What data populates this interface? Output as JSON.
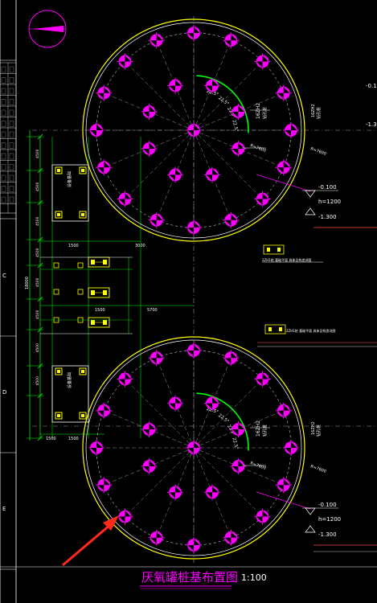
{
  "drawing": {
    "title": "厌氧罐桩基布置图",
    "scale": "1:100"
  },
  "colors": {
    "background": "#000000",
    "pile": "#ff00ff",
    "tank_outer": "#ffff00",
    "tank_inner": "#ffffff",
    "centerline": "#9a9a9a",
    "dimension": "#00ff00",
    "arc": "#00ff00",
    "annotation": "#ffffff",
    "frame": "#ffffff",
    "arrow": "#ff2a1a",
    "leader": "#ff00ff",
    "cap": "#ffff00"
  },
  "tank_top": {
    "pile_count_text": "16ZH2",
    "pile_note": "钻孔桩",
    "angle_labels": [
      "22.5°",
      "22.5°",
      "22.5°",
      "22.5°"
    ],
    "radius_label": "R=7600",
    "level_top": "-0.100",
    "level_h": "h=1200",
    "level_bottom": "-1.300"
  },
  "tank_bottom": {
    "pile_count_text": "16ZH2",
    "pile_note": "钻孔桩",
    "angle_labels": [
      "22.5°",
      "22.5°",
      "22.5°",
      "22.5°"
    ],
    "radius_label": "R=7600",
    "level_top": "-0.100",
    "level_h": "h=1200",
    "level_bottom": "-1.300"
  },
  "right_edge_labels": [
    "-0.10",
    "-1.30"
  ],
  "left_dims": {
    "vertical": [
      "4500",
      "4500",
      "4500",
      "4500",
      "4500",
      "4500",
      "4500",
      "4500"
    ],
    "total": "18000",
    "horizontal": [
      "1500",
      "1500",
      "3000",
      "1500",
      "1500",
      "1500",
      "3000"
    ],
    "middle_span": "5700"
  },
  "foundation_notes": {
    "upper": "2ZH1桩 基础平面 具体见构造详图",
    "lower": "2ZH1桩 基础平面 具体见构造详图"
  },
  "equipment_boxes": {
    "top_label": "设备基础",
    "bottom_label": "设备基础"
  },
  "frame_rows": [
    "C",
    "D",
    "E"
  ]
}
